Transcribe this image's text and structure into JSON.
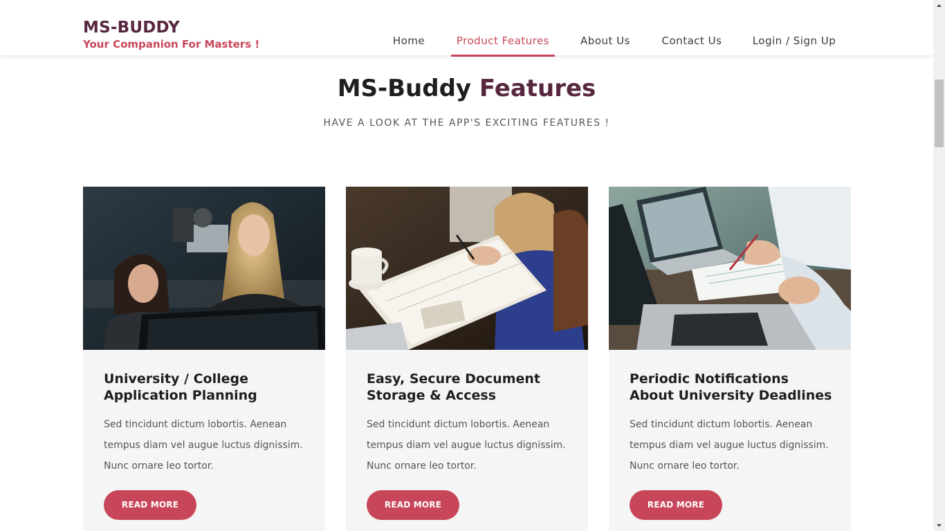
{
  "brand": {
    "name": "MS-BUDDY",
    "tagline": "Your Companion For Masters !"
  },
  "nav": {
    "items": [
      {
        "label": "Home",
        "active": false
      },
      {
        "label": "Product Features",
        "active": true
      },
      {
        "label": "About Us",
        "active": false
      },
      {
        "label": "Contact Us",
        "active": false
      },
      {
        "label": "Login / Sign Up",
        "active": false
      }
    ]
  },
  "section": {
    "title_main": "MS-Buddy ",
    "title_accent": "Features",
    "subtitle": "HAVE A LOOK AT THE APP'S EXCITING FEATURES !"
  },
  "cards": [
    {
      "title": "University / College Application Planning",
      "text": "Sed tincidunt dictum lobortis. Aenean tempus diam vel augue luctus dignissim. Nunc ornare leo tortor.",
      "button": "READ MORE",
      "image": "two-women-at-computer-photo"
    },
    {
      "title": "Easy, Secure Document Storage & Access",
      "text": "Sed tincidunt dictum lobortis. Aenean tempus diam vel augue luctus dignissim. Nunc ornare leo tortor.",
      "button": "READ MORE",
      "image": "writing-in-notebook-with-coffee-photo"
    },
    {
      "title": "Periodic Notifications About University Deadlines",
      "text": "Sed tincidunt dictum lobortis. Aenean tempus diam vel augue luctus dignissim. Nunc ornare leo tortor.",
      "button": "READ MORE",
      "image": "laptops-and-paperwork-photo"
    }
  ],
  "colors": {
    "brand": "#57263f",
    "accent": "#c84659",
    "card_bg": "#f5f5f5",
    "text": "#1e1e1e",
    "muted": "#555555"
  }
}
